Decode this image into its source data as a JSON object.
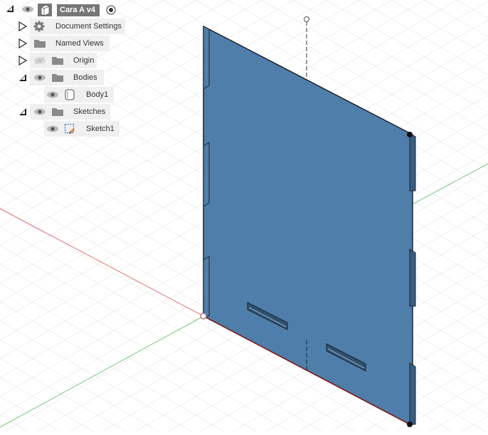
{
  "browser": {
    "root": {
      "label": "Cara A v4",
      "expanded": true
    },
    "items": [
      {
        "label": "Document Settings",
        "expanded": false,
        "icon": "gear-icon"
      },
      {
        "label": "Named Views",
        "expanded": false,
        "icon": "folder-icon"
      },
      {
        "label": "Origin",
        "expanded": false,
        "icon": "folder-icon",
        "visible": false
      },
      {
        "label": "Bodies",
        "expanded": true,
        "icon": "folder-icon"
      },
      {
        "label": "Body1",
        "icon": "body-icon"
      },
      {
        "label": "Sketches",
        "expanded": true,
        "icon": "folder-icon"
      },
      {
        "label": "Sketch1",
        "icon": "sketch-icon"
      }
    ]
  },
  "colors": {
    "part_face": "#4f7eaa",
    "part_edge": "#1a2530",
    "grid_line": "#d9d9d9",
    "axis_x": "#e06060",
    "axis_z": "#60d060"
  }
}
